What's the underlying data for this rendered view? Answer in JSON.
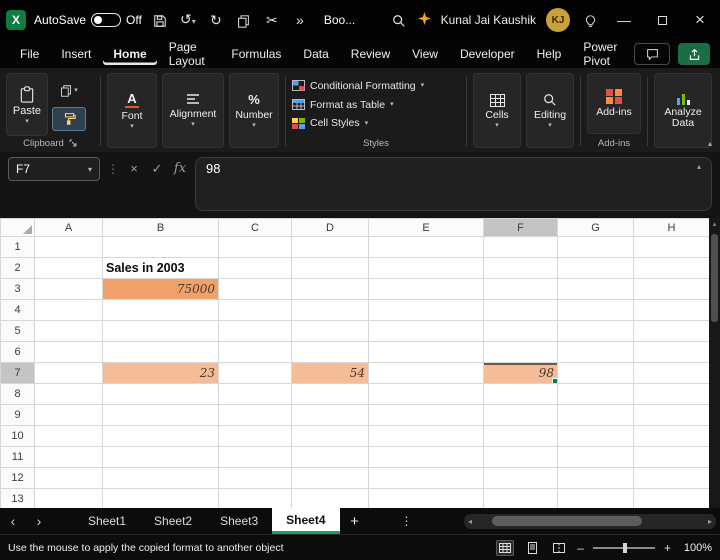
{
  "colors": {
    "accent_green": "#107c41",
    "cell_fill": "#efa06b",
    "copied_cell_fill": "#f5bc98",
    "copied_border_red": "#e82a2d",
    "active_tab_underline": "#18a05e"
  },
  "title_bar": {
    "app": "Excel",
    "autosave_label": "AutoSave",
    "autosave_state": "Off",
    "doc_name": "Boo...",
    "user_name": "Kunal Jai Kaushik",
    "user_initials": "KJ"
  },
  "menu_bar": {
    "items": [
      "File",
      "Insert",
      "Home",
      "Page Layout",
      "Formulas",
      "Data",
      "Review",
      "View",
      "Developer",
      "Help",
      "Power Pivot"
    ],
    "active_item": "Home"
  },
  "ribbon": {
    "paste": "Paste",
    "clipboard_group": "Clipboard",
    "font": "Font",
    "alignment": "Alignment",
    "number": "Number",
    "conditional_formatting": "Conditional Formatting",
    "format_as_table": "Format as Table",
    "cell_styles": "Cell Styles",
    "styles_group": "Styles",
    "cells": "Cells",
    "editing": "Editing",
    "add_ins": "Add-ins",
    "add_ins_group": "Add-ins",
    "analyze_data": "Analyze Data"
  },
  "formula_bar": {
    "name_box": "F7",
    "fx_label": "fx",
    "value": "98"
  },
  "grid": {
    "columns": [
      "A",
      "B",
      "C",
      "D",
      "E",
      "F",
      "G",
      "H"
    ],
    "rows": [
      "1",
      "2",
      "3",
      "4",
      "5",
      "6",
      "7",
      "8",
      "9",
      "10",
      "11",
      "12",
      "13"
    ],
    "selected_column": "F",
    "selected_row": "7",
    "cells": [
      {
        "ref": "B2",
        "text": "Sales in 2003",
        "kind": "title"
      },
      {
        "ref": "B3",
        "text": "75000",
        "kind": "filled"
      },
      {
        "ref": "B7",
        "text": "23",
        "kind": "copied"
      },
      {
        "ref": "D7",
        "text": "54",
        "kind": "copied"
      },
      {
        "ref": "F7",
        "text": "98",
        "kind": "copied active"
      }
    ]
  },
  "sheet_bar": {
    "tabs": [
      "Sheet1",
      "Sheet2",
      "Sheet3",
      "Sheet4"
    ],
    "active_tab": "Sheet4",
    "new_sheet": "+"
  },
  "status_bar": {
    "message": "Use the mouse to apply the copied format to another object",
    "zoom_level": "100%"
  }
}
